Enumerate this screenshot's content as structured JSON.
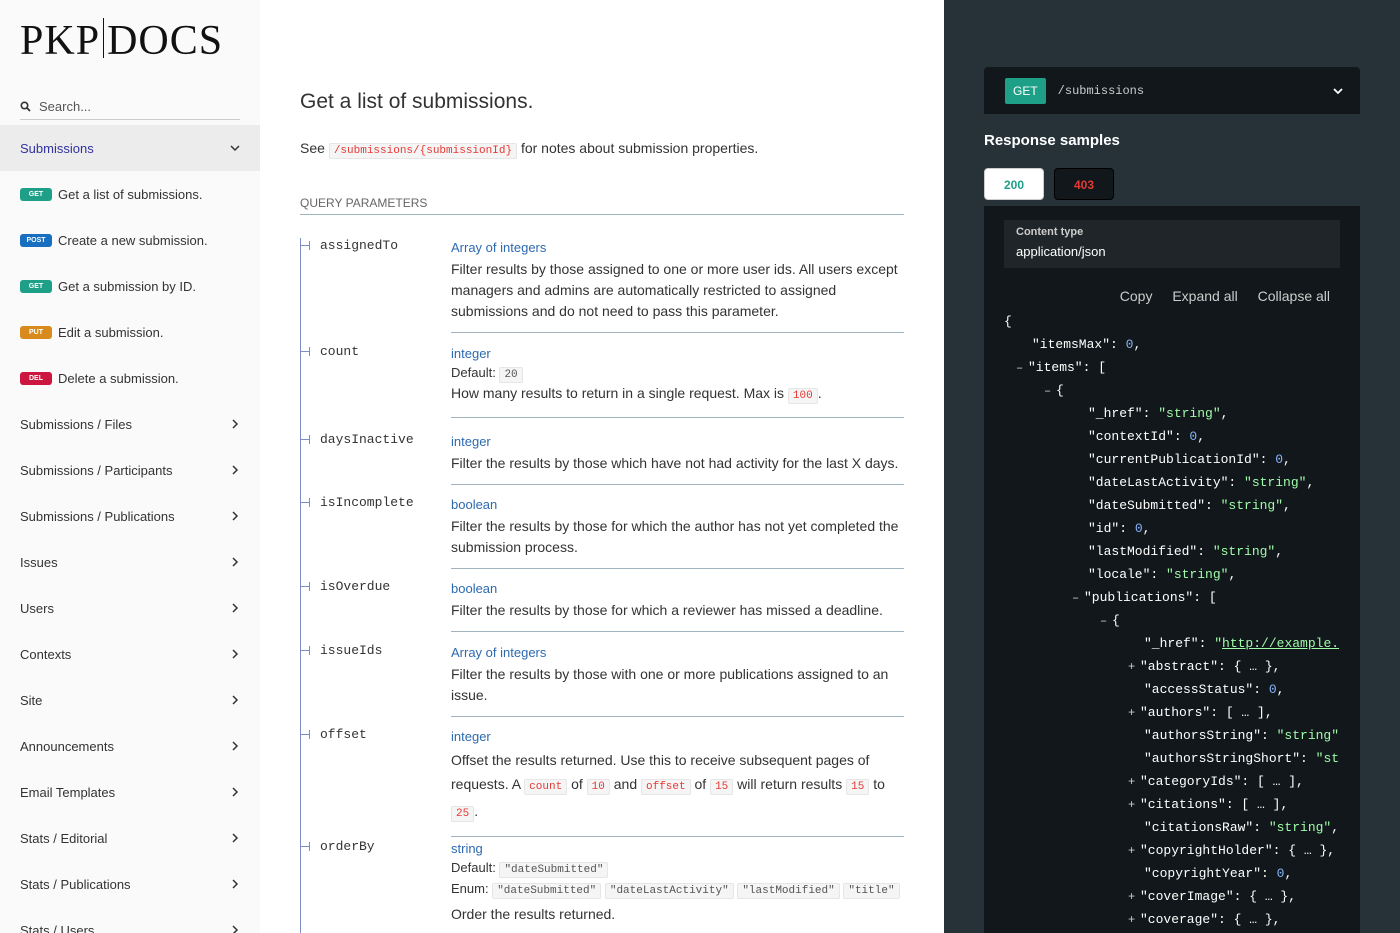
{
  "logo": "PKP|DOCS",
  "logo_left": "PKP",
  "logo_right": "DOCS",
  "search": {
    "placeholder": "Search..."
  },
  "sidebar": {
    "active_group": "Submissions",
    "operations": [
      {
        "method": "GET",
        "label": "Get a list of submissions."
      },
      {
        "method": "POST",
        "label": "Create a new submission."
      },
      {
        "method": "GET",
        "label": "Get a submission by ID."
      },
      {
        "method": "PUT",
        "label": "Edit a submission."
      },
      {
        "method": "DEL",
        "label": "Delete a submission."
      }
    ],
    "groups": [
      "Submissions / Files",
      "Submissions / Participants",
      "Submissions / Publications",
      "Issues",
      "Users",
      "Contexts",
      "Site",
      "Announcements",
      "Email Templates",
      "Stats / Editorial",
      "Stats / Publications",
      "Stats / Users"
    ]
  },
  "main": {
    "title": "Get a list of submissions.",
    "desc_see": "See",
    "desc_code": "/submissions/{submissionId}",
    "desc_rest": "for notes about submission properties.",
    "query_header": "QUERY PARAMETERS",
    "default_label": "Default:",
    "enum_label": "Enum:",
    "params": {
      "assignedTo": {
        "name": "assignedTo",
        "type": "Array of integers",
        "text": "Filter results by those assigned to one or more user ids. All users except managers and admins are automatically restricted to assigned submissions and do not need to pass this parameter."
      },
      "count": {
        "name": "count",
        "type": "integer",
        "default": "20",
        "text_pre": "How many results to return in a single request. Max is",
        "max": "100",
        "text_post": "."
      },
      "daysInactive": {
        "name": "daysInactive",
        "type": "integer",
        "text": "Filter the results by those which have not had activity for the last X days."
      },
      "isIncomplete": {
        "name": "isIncomplete",
        "type": "boolean",
        "text": "Filter the results by those for which the author has not yet completed the submission process."
      },
      "isOverdue": {
        "name": "isOverdue",
        "type": "boolean",
        "text": "Filter the results by those for which a reviewer has missed a deadline."
      },
      "issueIds": {
        "name": "issueIds",
        "type": "Array of integers",
        "text": "Filter the results by those with one or more publications assigned to an issue."
      },
      "offset": {
        "name": "offset",
        "type": "integer",
        "t1": "Offset the results returned. Use this to receive subsequent pages of requests. A",
        "c1": "count",
        "t2": "of",
        "c2": "10",
        "t3": "and",
        "c3": "offset",
        "t4": "of",
        "c4": "15",
        "t5": "will return results",
        "c5": "15",
        "t6": "to",
        "c6": "25",
        "t7": "."
      },
      "orderBy": {
        "name": "orderBy",
        "type": "string",
        "default": "\"dateSubmitted\"",
        "enum": [
          "\"dateSubmitted\"",
          "\"dateLastActivity\"",
          "\"lastModified\"",
          "\"title\""
        ],
        "text": "Order the results returned."
      }
    }
  },
  "right": {
    "method": "GET",
    "path": "/submissions",
    "samples_title": "Response samples",
    "tabs": [
      "200",
      "403"
    ],
    "content_type_label": "Content type",
    "content_type": "application/json",
    "actions": [
      "Copy",
      "Expand all",
      "Collapse all"
    ],
    "json_lines": [
      {
        "indent": 0,
        "tog": "",
        "text": "{"
      },
      {
        "indent": 1,
        "tog": "",
        "key": "\"itemsMax\"",
        "val": "0",
        "vt": "n",
        "tail": ","
      },
      {
        "indent": 1,
        "tog": "–",
        "key": "\"items\"",
        "val": "[",
        "vt": "p",
        "tail": ""
      },
      {
        "indent": 2,
        "tog": "–",
        "text": "{"
      },
      {
        "indent": 3,
        "tog": "",
        "key": "\"_href\"",
        "val": "\"string\"",
        "vt": "s",
        "tail": ","
      },
      {
        "indent": 3,
        "tog": "",
        "key": "\"contextId\"",
        "val": "0",
        "vt": "n",
        "tail": ","
      },
      {
        "indent": 3,
        "tog": "",
        "key": "\"currentPublicationId\"",
        "val": "0",
        "vt": "n",
        "tail": ","
      },
      {
        "indent": 3,
        "tog": "",
        "key": "\"dateLastActivity\"",
        "val": "\"string\"",
        "vt": "s",
        "tail": ","
      },
      {
        "indent": 3,
        "tog": "",
        "key": "\"dateSubmitted\"",
        "val": "\"string\"",
        "vt": "s",
        "tail": ","
      },
      {
        "indent": 3,
        "tog": "",
        "key": "\"id\"",
        "val": "0",
        "vt": "n",
        "tail": ","
      },
      {
        "indent": 3,
        "tog": "",
        "key": "\"lastModified\"",
        "val": "\"string\"",
        "vt": "s",
        "tail": ","
      },
      {
        "indent": 3,
        "tog": "",
        "key": "\"locale\"",
        "val": "\"string\"",
        "vt": "s",
        "tail": ","
      },
      {
        "indent": 3,
        "tog": "–",
        "key": "\"publications\"",
        "val": "[",
        "vt": "p",
        "tail": ""
      },
      {
        "indent": 4,
        "tog": "–",
        "text": "{"
      },
      {
        "indent": 5,
        "tog": "",
        "key": "\"_href\"",
        "val": "\"http://example.",
        "vt": "l",
        "tail": ""
      },
      {
        "indent": 5,
        "tog": "+",
        "key": "\"abstract\"",
        "val": "{ … }",
        "vt": "p",
        "tail": ","
      },
      {
        "indent": 5,
        "tog": "",
        "key": "\"accessStatus\"",
        "val": "0",
        "vt": "n",
        "tail": ","
      },
      {
        "indent": 5,
        "tog": "+",
        "key": "\"authors\"",
        "val": "[ … ]",
        "vt": "p",
        "tail": ","
      },
      {
        "indent": 5,
        "tog": "",
        "key": "\"authorsString\"",
        "val": "\"string\"",
        "vt": "s",
        "tail": ""
      },
      {
        "indent": 5,
        "tog": "",
        "key": "\"authorsStringShort\"",
        "val": "\"st",
        "vt": "s",
        "tail": ""
      },
      {
        "indent": 5,
        "tog": "+",
        "key": "\"categoryIds\"",
        "val": "[ … ]",
        "vt": "p",
        "tail": ","
      },
      {
        "indent": 5,
        "tog": "+",
        "key": "\"citations\"",
        "val": "[ … ]",
        "vt": "p",
        "tail": ","
      },
      {
        "indent": 5,
        "tog": "",
        "key": "\"citationsRaw\"",
        "val": "\"string\"",
        "vt": "s",
        "tail": ","
      },
      {
        "indent": 5,
        "tog": "+",
        "key": "\"copyrightHolder\"",
        "val": "{ … }",
        "vt": "p",
        "tail": ","
      },
      {
        "indent": 5,
        "tog": "",
        "key": "\"copyrightYear\"",
        "val": "0",
        "vt": "n",
        "tail": ","
      },
      {
        "indent": 5,
        "tog": "+",
        "key": "\"coverImage\"",
        "val": "{ … }",
        "vt": "p",
        "tail": ","
      },
      {
        "indent": 5,
        "tog": "+",
        "key": "\"coverage\"",
        "val": "{ … }",
        "vt": "p",
        "tail": ","
      }
    ]
  },
  "colors": {
    "get": "#1e9f88",
    "post": "#186fc0",
    "put": "#d98a1d",
    "del": "#cc1640",
    "link": "#2d6ab0"
  }
}
